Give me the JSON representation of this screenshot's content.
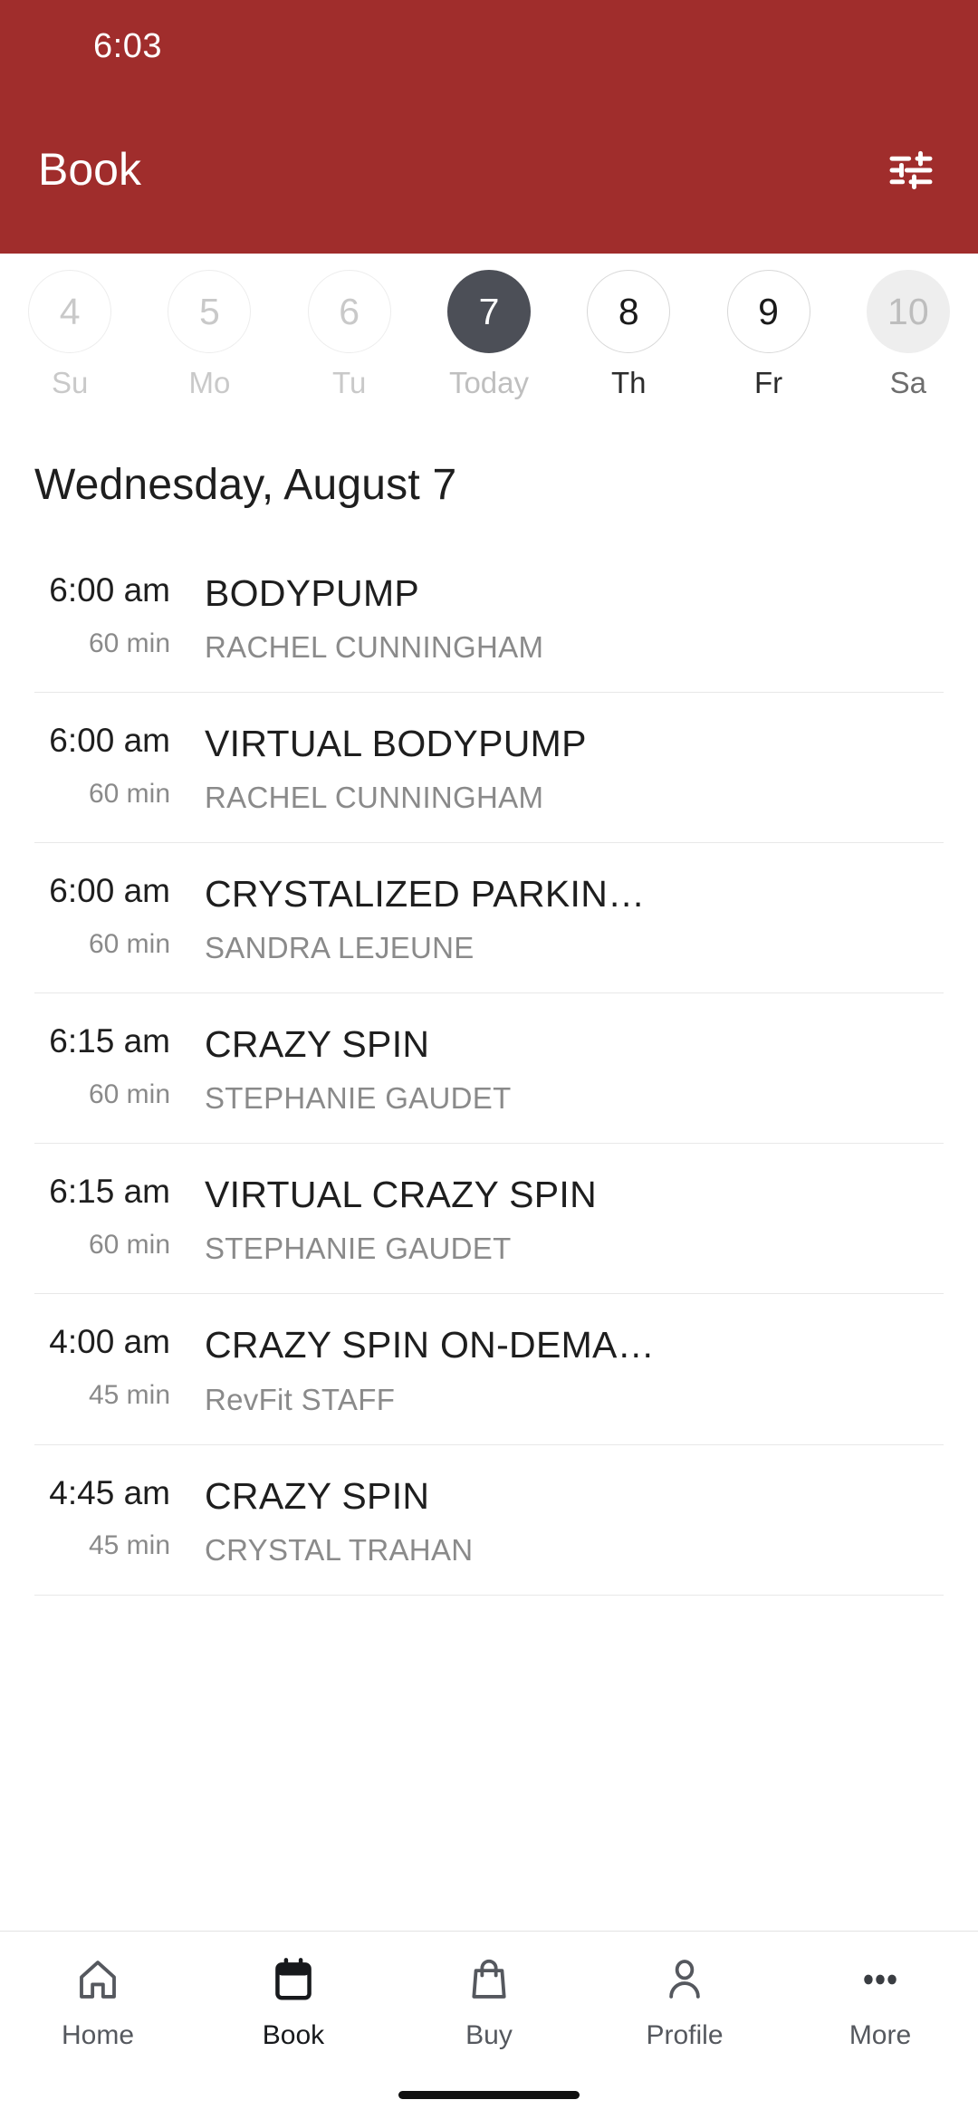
{
  "status_bar": {
    "time": "6:03"
  },
  "header": {
    "title": "Book",
    "filter_icon": "tune-filter-icon",
    "background_color": "#A02D2C",
    "text_color": "#FFFFFF"
  },
  "date_strip": {
    "selected_index": 3,
    "selected_color": "#4C4F57",
    "days": [
      {
        "day_number": "4",
        "weekday": "Su",
        "state": "past"
      },
      {
        "day_number": "5",
        "weekday": "Mo",
        "state": "past"
      },
      {
        "day_number": "6",
        "weekday": "Tu",
        "state": "past"
      },
      {
        "day_number": "7",
        "weekday": "Today",
        "state": "today"
      },
      {
        "day_number": "8",
        "weekday": "Th",
        "state": "future"
      },
      {
        "day_number": "9",
        "weekday": "Fr",
        "state": "future"
      },
      {
        "day_number": "10",
        "weekday": "Sa",
        "state": "muted"
      }
    ]
  },
  "schedule": {
    "day_title": "Wednesday, August 7",
    "classes": [
      {
        "time": "6:00 am",
        "duration": "60 min",
        "name": "BODYPUMP",
        "instructor": "RACHEL CUNNINGHAM"
      },
      {
        "time": "6:00 am",
        "duration": "60 min",
        "name": "VIRTUAL BODYPUMP",
        "instructor": "RACHEL CUNNINGHAM"
      },
      {
        "time": "6:00 am",
        "duration": "60 min",
        "name": "CRYSTALIZED PARKIN…",
        "instructor": "SANDRA LEJEUNE"
      },
      {
        "time": "6:15 am",
        "duration": "60 min",
        "name": "CRAZY SPIN",
        "instructor": "STEPHANIE GAUDET"
      },
      {
        "time": "6:15 am",
        "duration": "60 min",
        "name": "VIRTUAL CRAZY SPIN",
        "instructor": "STEPHANIE GAUDET"
      },
      {
        "time": "4:00 am",
        "duration": "45 min",
        "name": "CRAZY SPIN ON-DEMA…",
        "instructor": "RevFit STAFF"
      },
      {
        "time": "4:45 am",
        "duration": "45 min",
        "name": "CRAZY SPIN",
        "instructor": "CRYSTAL TRAHAN"
      }
    ]
  },
  "bottom_nav": {
    "active_index": 1,
    "items": [
      {
        "label": "Home",
        "icon": "home-icon"
      },
      {
        "label": "Book",
        "icon": "calendar-icon"
      },
      {
        "label": "Buy",
        "icon": "shopping-bag-icon"
      },
      {
        "label": "Profile",
        "icon": "person-icon"
      },
      {
        "label": "More",
        "icon": "more-dots-icon"
      }
    ]
  }
}
